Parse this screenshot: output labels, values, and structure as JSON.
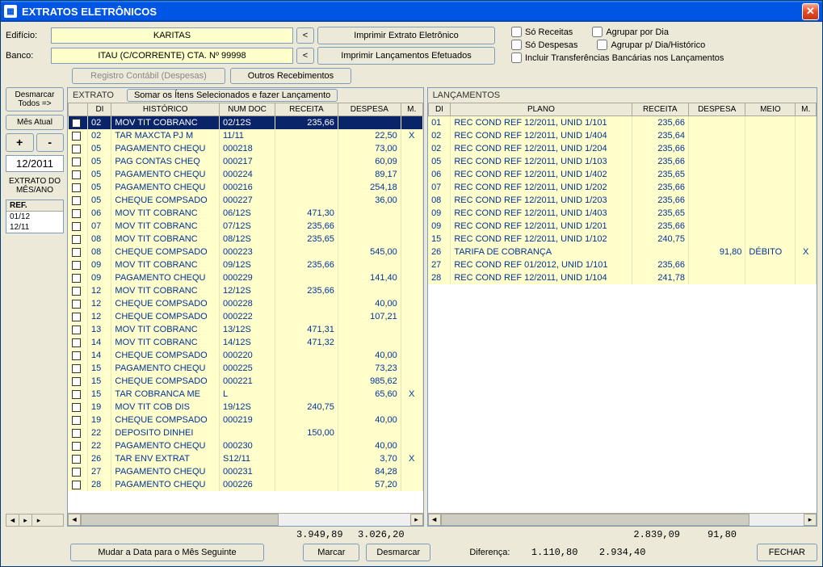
{
  "titlebar": {
    "title": "EXTRATOS ELETRÔNICOS"
  },
  "fields": {
    "edificio_label": "Edifício:",
    "edificio_value": "KARITAS",
    "banco_label": "Banco:",
    "banco_value": "ITAU (C/CORRENTE) CTA. Nº 99998"
  },
  "topbuttons": {
    "back1": "<",
    "back2": "<",
    "print_extrato": "Imprimir Extrato Eletrônico",
    "print_lanc": "Imprimir Lançamentos Efetuados",
    "registro": "Registro Contábil (Despesas)",
    "outros": "Outros Recebimentos"
  },
  "checkboxes": {
    "so_receitas": "Só Receitas",
    "agrupar_dia": "Agrupar por Dia",
    "so_despesas": "Só Despesas",
    "agrupar_dia_hist": "Agrupar p/ Dia/Histórico",
    "incluir_transf": "Incluir Transferências Bancárias nos Lançamentos"
  },
  "sidebar": {
    "desmarcar": "Desmarcar Todos =>",
    "mes_atual": "Mês Atual",
    "plus": "+",
    "minus": "-",
    "date": "12/2011",
    "extrato_do": "EXTRATO DO MÊS/ANO",
    "ref_hdr": "REF.",
    "refs": [
      "01/12",
      "12/11"
    ]
  },
  "extrato": {
    "title": "EXTRATO",
    "somar_btn": "Somar os Ítens Selecionados e fazer Lançamento",
    "cols": {
      "di": "DI",
      "hist": "HISTÓRICO",
      "num": "NUM DOC",
      "rec": "RECEITA",
      "desp": "DESPESA",
      "m": "M."
    },
    "rows": [
      {
        "di": "02",
        "hist": "MOV TIT COBRANC",
        "num": "02/12S",
        "rec": "235,66",
        "desp": "",
        "m": "",
        "sel": true
      },
      {
        "di": "02",
        "hist": "TAR MAXCTA PJ M",
        "num": "11/11",
        "rec": "",
        "desp": "22,50",
        "m": "X"
      },
      {
        "di": "05",
        "hist": "PAGAMENTO CHEQU",
        "num": "000218",
        "rec": "",
        "desp": "73,00",
        "m": ""
      },
      {
        "di": "05",
        "hist": "PAG CONTAS CHEQ",
        "num": "000217",
        "rec": "",
        "desp": "60,09",
        "m": ""
      },
      {
        "di": "05",
        "hist": "PAGAMENTO CHEQU",
        "num": "000224",
        "rec": "",
        "desp": "89,17",
        "m": ""
      },
      {
        "di": "05",
        "hist": "PAGAMENTO CHEQU",
        "num": "000216",
        "rec": "",
        "desp": "254,18",
        "m": ""
      },
      {
        "di": "05",
        "hist": "CHEQUE COMPSADO",
        "num": "000227",
        "rec": "",
        "desp": "36,00",
        "m": ""
      },
      {
        "di": "06",
        "hist": "MOV TIT COBRANC",
        "num": "06/12S",
        "rec": "471,30",
        "desp": "",
        "m": ""
      },
      {
        "di": "07",
        "hist": "MOV TIT COBRANC",
        "num": "07/12S",
        "rec": "235,66",
        "desp": "",
        "m": ""
      },
      {
        "di": "08",
        "hist": "MOV TIT COBRANC",
        "num": "08/12S",
        "rec": "235,65",
        "desp": "",
        "m": ""
      },
      {
        "di": "08",
        "hist": "CHEQUE COMPSADO",
        "num": "000223",
        "rec": "",
        "desp": "545,00",
        "m": ""
      },
      {
        "di": "09",
        "hist": "MOV TIT COBRANC",
        "num": "09/12S",
        "rec": "235,66",
        "desp": "",
        "m": ""
      },
      {
        "di": "09",
        "hist": "PAGAMENTO CHEQU",
        "num": "000229",
        "rec": "",
        "desp": "141,40",
        "m": ""
      },
      {
        "di": "12",
        "hist": "MOV TIT COBRANC",
        "num": "12/12S",
        "rec": "235,66",
        "desp": "",
        "m": ""
      },
      {
        "di": "12",
        "hist": "CHEQUE COMPSADO",
        "num": "000228",
        "rec": "",
        "desp": "40,00",
        "m": ""
      },
      {
        "di": "12",
        "hist": "CHEQUE COMPSADO",
        "num": "000222",
        "rec": "",
        "desp": "107,21",
        "m": ""
      },
      {
        "di": "13",
        "hist": "MOV TIT COBRANC",
        "num": "13/12S",
        "rec": "471,31",
        "desp": "",
        "m": ""
      },
      {
        "di": "14",
        "hist": "MOV TIT COBRANC",
        "num": "14/12S",
        "rec": "471,32",
        "desp": "",
        "m": ""
      },
      {
        "di": "14",
        "hist": "CHEQUE COMPSADO",
        "num": "000220",
        "rec": "",
        "desp": "40,00",
        "m": ""
      },
      {
        "di": "15",
        "hist": "PAGAMENTO CHEQU",
        "num": "000225",
        "rec": "",
        "desp": "73,23",
        "m": ""
      },
      {
        "di": "15",
        "hist": "CHEQUE COMPSADO",
        "num": "000221",
        "rec": "",
        "desp": "985,62",
        "m": ""
      },
      {
        "di": "15",
        "hist": "TAR COBRANCA ME",
        "num": "L",
        "rec": "",
        "desp": "65,60",
        "m": "X"
      },
      {
        "di": "19",
        "hist": "MOV TIT COB DIS",
        "num": "19/12S",
        "rec": "240,75",
        "desp": "",
        "m": ""
      },
      {
        "di": "19",
        "hist": "CHEQUE COMPSADO",
        "num": "000219",
        "rec": "",
        "desp": "40,00",
        "m": ""
      },
      {
        "di": "22",
        "hist": "DEPOSITO DINHEI",
        "num": "",
        "rec": "150,00",
        "desp": "",
        "m": ""
      },
      {
        "di": "22",
        "hist": "PAGAMENTO CHEQU",
        "num": "000230",
        "rec": "",
        "desp": "40,00",
        "m": ""
      },
      {
        "di": "26",
        "hist": "TAR ENV EXTRAT",
        "num": "S12/11",
        "rec": "",
        "desp": "3,70",
        "m": "X"
      },
      {
        "di": "27",
        "hist": "PAGAMENTO CHEQU",
        "num": "000231",
        "rec": "",
        "desp": "84,28",
        "m": ""
      },
      {
        "di": "28",
        "hist": "PAGAMENTO CHEQU",
        "num": "000226",
        "rec": "",
        "desp": "57,20",
        "m": ""
      }
    ],
    "total_rec": "3.949,89",
    "total_desp": "3.026,20"
  },
  "lanc": {
    "title": "LANÇAMENTOS",
    "cols": {
      "di": "DI",
      "plano": "PLANO",
      "rec": "RECEITA",
      "desp": "DESPESA",
      "meio": "MEIO",
      "m": "M."
    },
    "rows": [
      {
        "di": "01",
        "plano": "REC COND REF 12/2011, UNID 1/101",
        "rec": "235,66",
        "desp": "",
        "meio": "",
        "m": ""
      },
      {
        "di": "02",
        "plano": "REC COND REF 12/2011, UNID 1/404",
        "rec": "235,64",
        "desp": "",
        "meio": "",
        "m": ""
      },
      {
        "di": "02",
        "plano": "REC COND REF 12/2011, UNID 1/204",
        "rec": "235,66",
        "desp": "",
        "meio": "",
        "m": ""
      },
      {
        "di": "05",
        "plano": "REC COND REF 12/2011, UNID 1/103",
        "rec": "235,66",
        "desp": "",
        "meio": "",
        "m": ""
      },
      {
        "di": "06",
        "plano": "REC COND REF 12/2011, UNID 1/402",
        "rec": "235,65",
        "desp": "",
        "meio": "",
        "m": ""
      },
      {
        "di": "07",
        "plano": "REC COND REF 12/2011, UNID 1/202",
        "rec": "235,66",
        "desp": "",
        "meio": "",
        "m": ""
      },
      {
        "di": "08",
        "plano": "REC COND REF 12/2011, UNID 1/203",
        "rec": "235,66",
        "desp": "",
        "meio": "",
        "m": ""
      },
      {
        "di": "09",
        "plano": "REC COND REF 12/2011, UNID 1/403",
        "rec": "235,65",
        "desp": "",
        "meio": "",
        "m": ""
      },
      {
        "di": "09",
        "plano": "REC COND REF 12/2011, UNID 1/201",
        "rec": "235,66",
        "desp": "",
        "meio": "",
        "m": ""
      },
      {
        "di": "15",
        "plano": "REC COND REF 12/2011, UNID 1/102",
        "rec": "240,75",
        "desp": "",
        "meio": "",
        "m": ""
      },
      {
        "di": "26",
        "plano": "TARIFA DE COBRANÇA",
        "rec": "",
        "desp": "91,80",
        "meio": "DÉBITO",
        "m": "X"
      },
      {
        "di": "27",
        "plano": "REC COND REF 01/2012, UNID 1/101",
        "rec": "235,66",
        "desp": "",
        "meio": "",
        "m": ""
      },
      {
        "di": "28",
        "plano": "REC COND REF 12/2011, UNID 1/104",
        "rec": "241,78",
        "desp": "",
        "meio": "",
        "m": ""
      }
    ],
    "total_rec": "2.839,09",
    "total_desp": "91,80"
  },
  "bottom": {
    "mudar_data": "Mudar a Data para o Mês Seguinte",
    "marcar": "Marcar",
    "desmarcar": "Desmarcar",
    "diferenca_label": "Diferença:",
    "dif_rec": "1.110,80",
    "dif_desp": "2.934,40",
    "fechar": "FECHAR"
  }
}
